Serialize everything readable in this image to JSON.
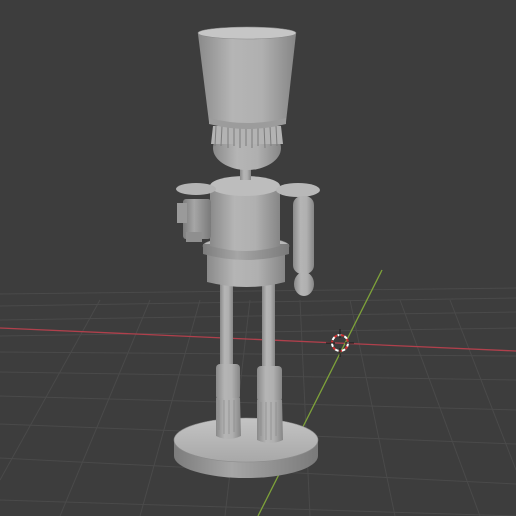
{
  "viewport": {
    "background": "#3d3d3d",
    "grid_color": "#4a4a4a",
    "x_axis_color": "#b0404c",
    "y_axis_color": "#7ea23a",
    "model_color": "#a9a9a9",
    "model_shadow": "#858585",
    "model_highlight": "#c2c2c2"
  },
  "scene": {
    "object": "nutcracker-soldier-model",
    "cursor": "3d-cursor-icon"
  }
}
